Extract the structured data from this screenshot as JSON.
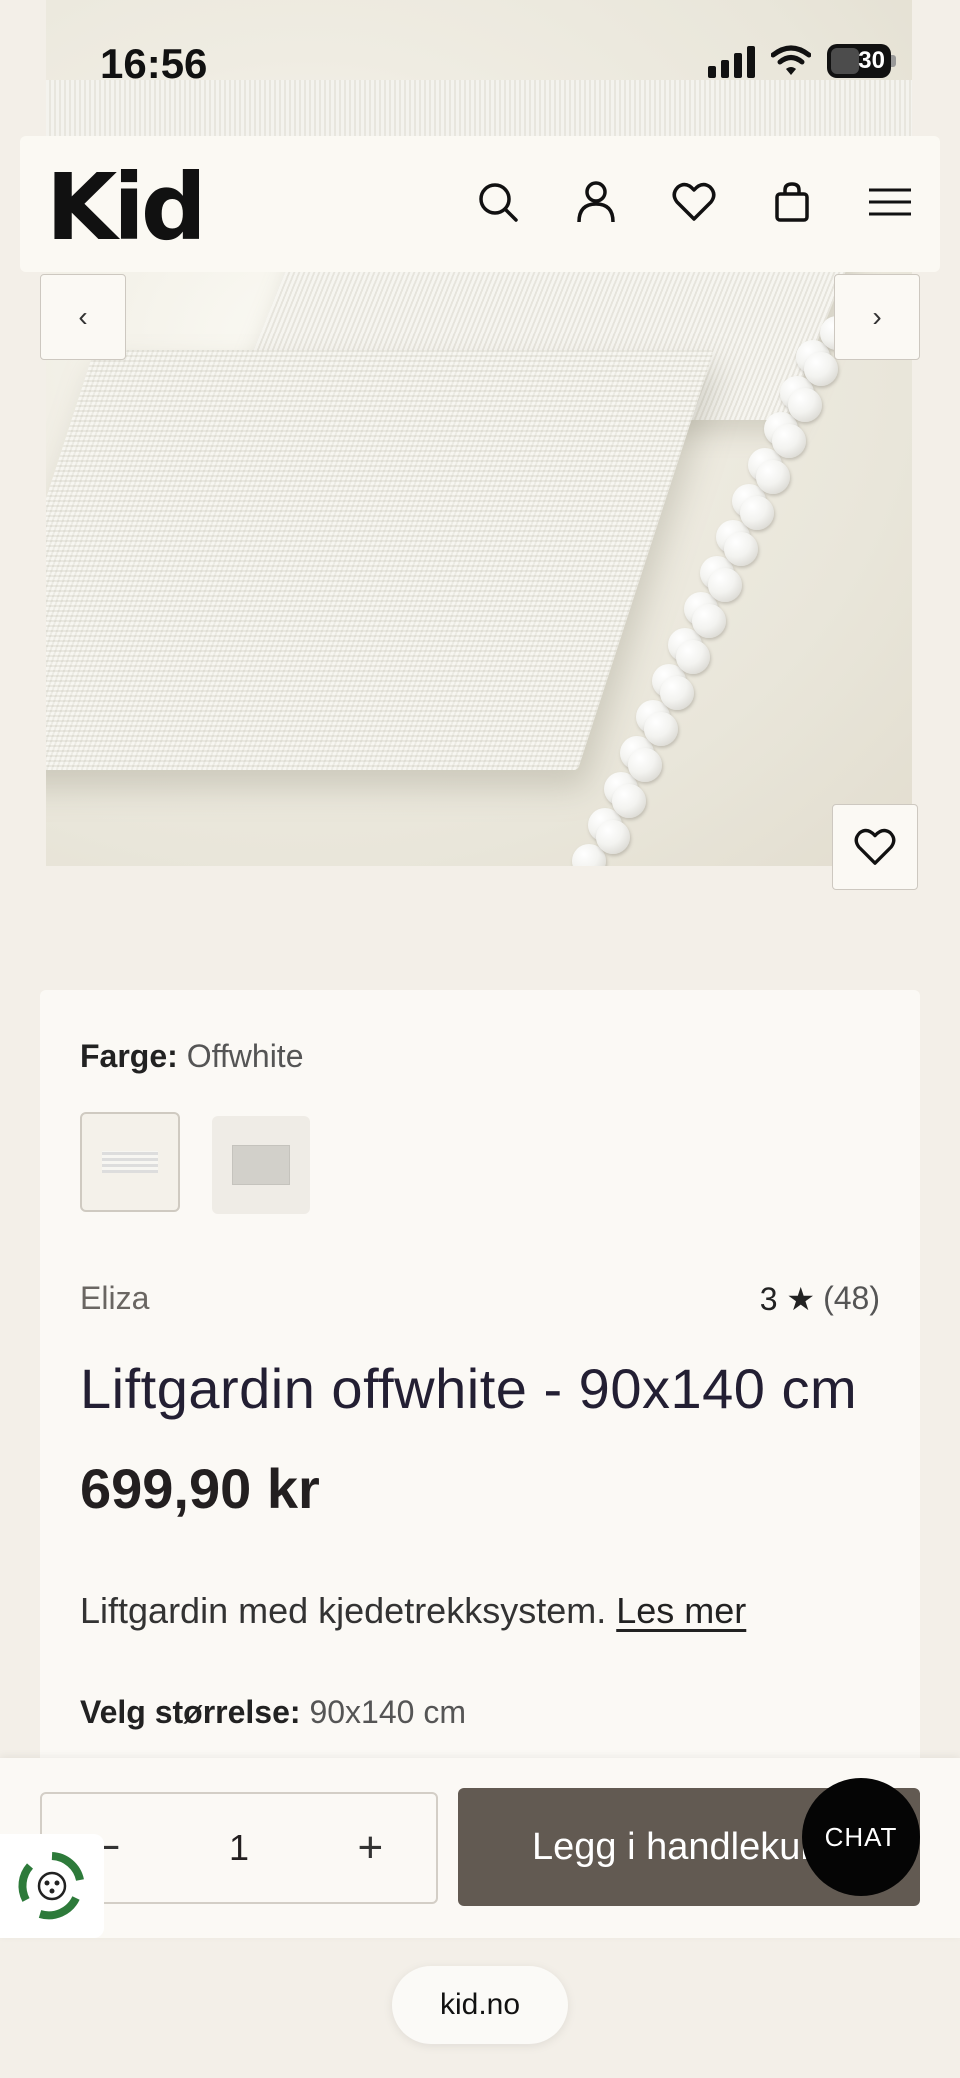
{
  "status_bar": {
    "time": "16:56",
    "battery": "30"
  },
  "header": {
    "logo": "Kid"
  },
  "hero": {
    "prev_label": "‹",
    "next_label": "›"
  },
  "product": {
    "color_label": "Farge:",
    "color_value": "Offwhite",
    "brand": "Eliza",
    "rating": "3 ★",
    "review_count": "(48)",
    "title": "Liftgardin offwhite - 90x140 cm",
    "price": "699,90 kr",
    "description": "Liftgardin med kjedetrekksystem.",
    "read_more": "Les mer",
    "size_label": "Velg størrelse:",
    "size_value": "90x140 cm"
  },
  "cart_bar": {
    "minus": "−",
    "quantity": "1",
    "plus": "+",
    "add_to_cart": "Legg i handlekurv"
  },
  "chat": {
    "label": "CHAT"
  },
  "browser": {
    "domain": "kid.no"
  },
  "colors": {
    "button": "#625a52",
    "background": "#f3efe8",
    "card": "#fbf9f5"
  }
}
